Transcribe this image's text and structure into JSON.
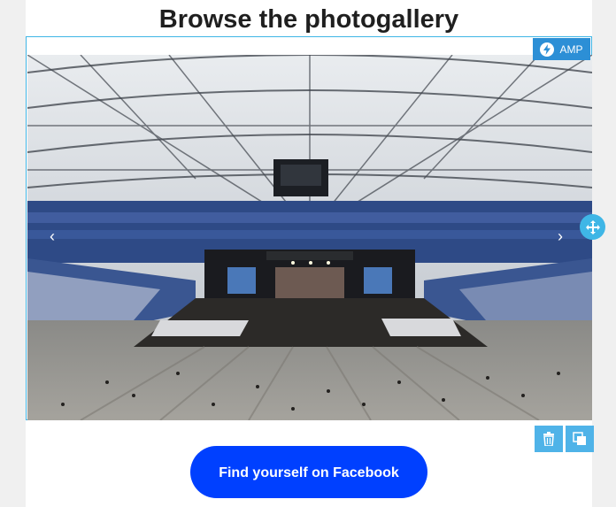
{
  "page": {
    "title": "Browse the photogallery"
  },
  "gallery": {
    "badge_label": "AMP",
    "prev_arrow": "‹",
    "next_arrow": "›",
    "image_subject": "stadium-concert-photo"
  },
  "cta": {
    "label": "Find yourself on Facebook"
  },
  "colors": {
    "accent": "#3fb6e6",
    "amp_badge": "#2c8fd6",
    "button": "#0040ff",
    "title": "#1f1f1f"
  }
}
